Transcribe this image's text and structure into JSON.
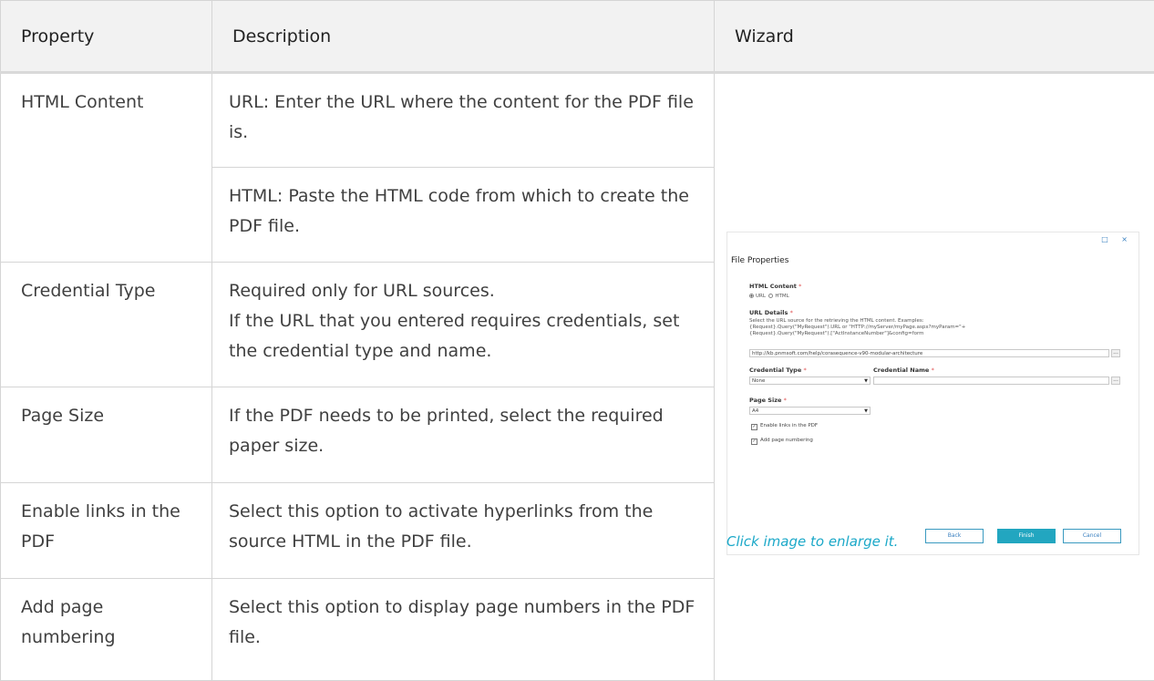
{
  "table": {
    "headers": [
      "Property",
      "Description",
      "Wizard"
    ],
    "rows": [
      {
        "property": "HTML Content",
        "description": "URL: Enter the URL where the content for the PDF file is."
      },
      {
        "property": "",
        "description": "HTML: Paste the HTML code from which to create the PDF file."
      },
      {
        "property": "Credential Type",
        "description_line1": "Required only for URL sources.",
        "description_line2": "If the URL that you entered requires credentials, set the credential type and name."
      },
      {
        "property": "Page Size",
        "description": "If the PDF needs to be printed, select the required paper size."
      },
      {
        "property": "Enable links in the PDF",
        "description": "Select this option to activate hyperlinks from the source HTML in the PDF file."
      },
      {
        "property": "Add page numbering",
        "description": "Select this option to display page numbers in the PDF file."
      }
    ]
  },
  "wizard": {
    "title": "File Properties",
    "window_controls": "□ ×",
    "required_mark": "*",
    "html_content_label": "HTML Content",
    "radio_url": "URL",
    "radio_html": "HTML",
    "url_details_label": "URL Details",
    "url_help_1": "Select the URL source for the retrieving the HTML content. Examples:",
    "url_help_2": "{Request}.Query(\"MyRequest\").URL or \"HTTP://myServer/myPage.aspx?myParam=\"+",
    "url_help_3": "{Request}.Query(\"MyRequest\").[\"ActInstanceNumber\"]&config=form",
    "url_value": "http://kb.pnmsoft.com/help/corasequence-v90-modular-architecture",
    "browse_label": "...",
    "credential_type_label": "Credential Type",
    "credential_type_value": "None",
    "credential_name_label": "Credential Name",
    "credential_name_value": "",
    "page_size_label": "Page Size",
    "page_size_value": "A4",
    "enable_links_label": "Enable links in the PDF",
    "add_numbering_label": "Add page numbering",
    "back_button": "Back",
    "finish_button": "Finish",
    "cancel_button": "Cancel"
  },
  "caption": "Click image to enlarge it.",
  "colors": {
    "accent": "#22a6c0",
    "header_bg": "#f2f2f2",
    "border": "#d5d5d5"
  }
}
